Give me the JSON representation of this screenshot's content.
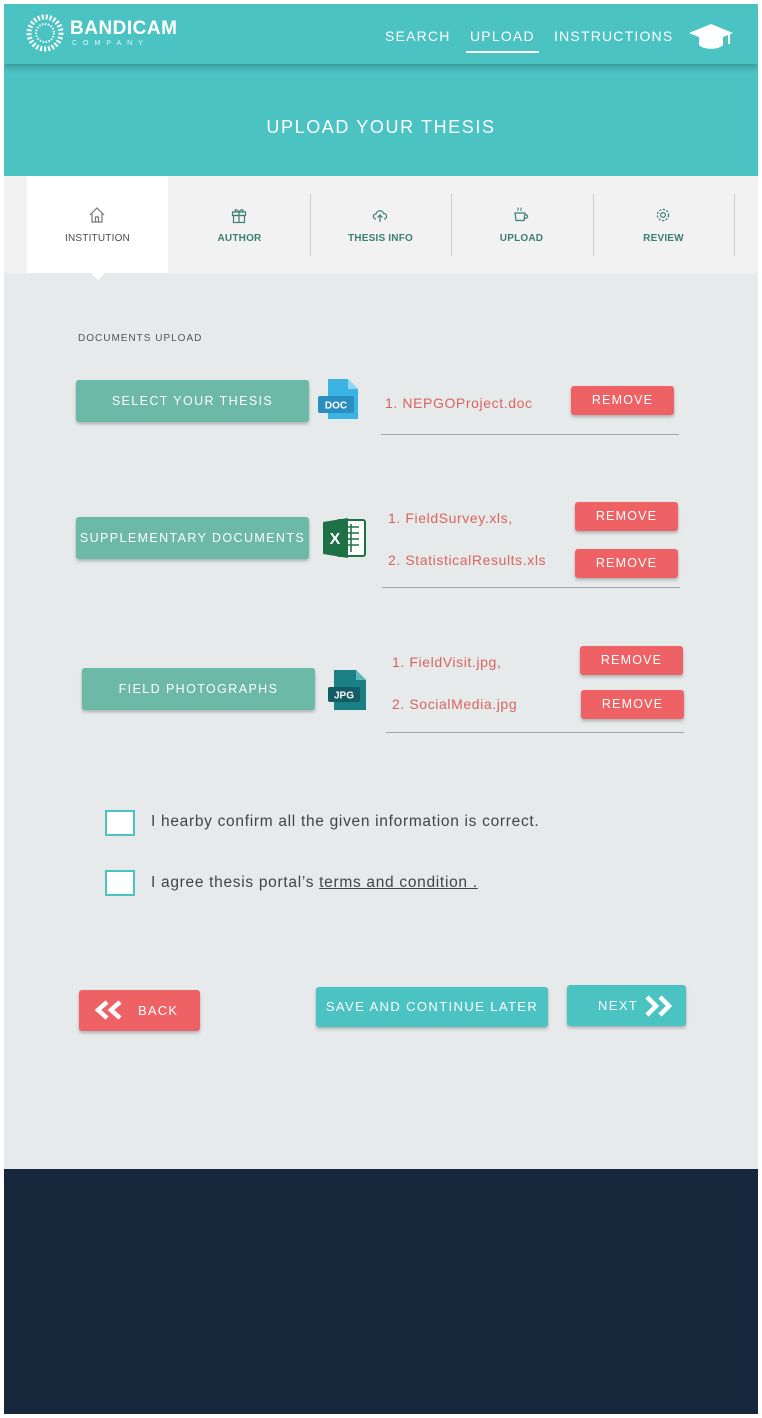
{
  "brand": {
    "name": "BANDICAM",
    "tagline": "COMPANY"
  },
  "nav": {
    "items": [
      "SEARCH",
      "UPLOAD",
      "INSTRUCTIONS"
    ],
    "active": "UPLOAD"
  },
  "hero": {
    "title": "UPLOAD YOUR THESIS"
  },
  "steps": [
    {
      "label": "INSTITUTION",
      "icon": "home-icon",
      "active": true
    },
    {
      "label": "AUTHOR",
      "icon": "gift-icon",
      "active": false
    },
    {
      "label": "THESIS INFO",
      "icon": "cloud-upload-icon",
      "active": false
    },
    {
      "label": "UPLOAD",
      "icon": "coffee-cup-icon",
      "active": false
    },
    {
      "label": "REVIEW",
      "icon": "gear-icon",
      "active": false
    }
  ],
  "documents": {
    "section_label": "DOCUMENTS UPLOAD",
    "groups": [
      {
        "button": "SELECT YOUR THESIS",
        "icon": "doc-file-icon",
        "icon_label": "DOC",
        "files": [
          {
            "name": "1. NEPGOProject.doc",
            "remove": "REMOVE"
          }
        ]
      },
      {
        "button": "SUPPLEMENTARY DOCUMENTS",
        "icon": "excel-file-icon",
        "icon_label": "X",
        "files": [
          {
            "name": "1. FieldSurvey.xls,",
            "remove": "REMOVE"
          },
          {
            "name": "2. StatisticalResults.xls",
            "remove": "REMOVE"
          }
        ]
      },
      {
        "button": "FIELD PHOTOGRAPHS",
        "icon": "jpg-file-icon",
        "icon_label": "JPG",
        "files": [
          {
            "name": "1. FieldVisit.jpg,",
            "remove": "REMOVE"
          },
          {
            "name": "2. SocialMedia.jpg",
            "remove": "REMOVE"
          }
        ]
      }
    ]
  },
  "confirm": {
    "line1": "I hearby confirm all the given information is correct.",
    "line2_prefix": "I agree thesis portal’s ",
    "line2_link": "terms and condition ."
  },
  "actions": {
    "back": "BACK",
    "save": "SAVE AND CONTINUE LATER",
    "next": "NEXT"
  },
  "colors": {
    "teal": "#4bc3c3",
    "green_button": "#6bb9a6",
    "red_button": "#ee6265",
    "footer": "#17283d",
    "file_text": "#d9645f"
  }
}
